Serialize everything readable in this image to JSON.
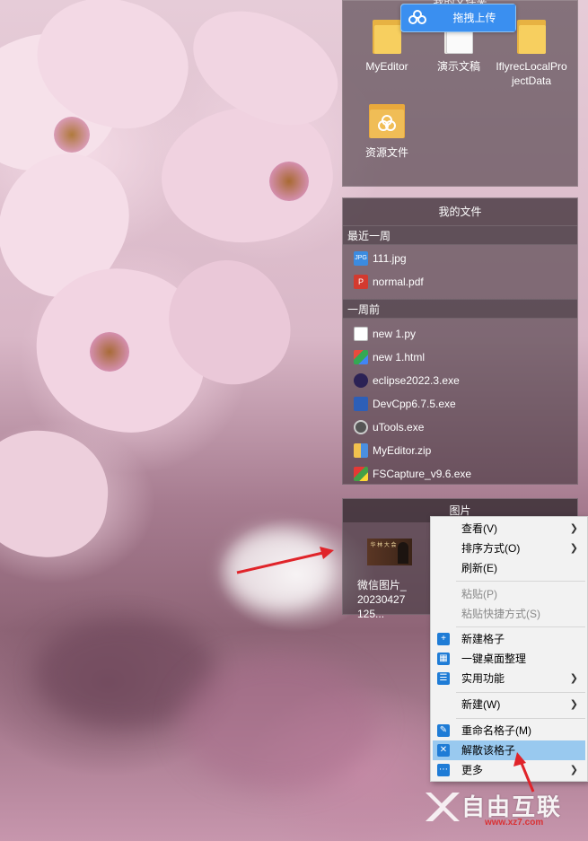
{
  "top_toolbar": {
    "upload_label": "拖拽上传",
    "partial_title": "我的文件夹"
  },
  "desktop_items": [
    {
      "label": "MyEditor",
      "icon": "folder-icon"
    },
    {
      "label": "演示文稿",
      "icon": "document-folder-icon"
    },
    {
      "label": "IflyrecLocalProjectData",
      "icon": "folder-icon"
    },
    {
      "label": "资源文件",
      "icon": "resource-folder-icon"
    }
  ],
  "my_files": {
    "title": "我的文件",
    "sections": [
      {
        "heading": "最近一周",
        "files": [
          {
            "name": "111.jpg",
            "icon": "jpg-icon"
          },
          {
            "name": "normal.pdf",
            "icon": "pdf-icon"
          }
        ]
      },
      {
        "heading": "一周前",
        "files": [
          {
            "name": "new 1.py",
            "icon": "py-file-icon"
          },
          {
            "name": "new 1.html",
            "icon": "html-file-icon"
          },
          {
            "name": "eclipse2022.3.exe",
            "icon": "eclipse-icon"
          },
          {
            "name": "DevCpp6.7.5.exe",
            "icon": "devcpp-icon"
          },
          {
            "name": "uTools.exe",
            "icon": "utools-icon"
          },
          {
            "name": "MyEditor.zip",
            "icon": "zip-icon"
          },
          {
            "name": "FSCapture_v9.6.exe",
            "icon": "fscapture-icon"
          }
        ]
      }
    ]
  },
  "pictures": {
    "title": "图片",
    "item_label": "微信图片_20230427125...",
    "thumb_text": "华 林 大 会"
  },
  "context_menu": {
    "items": [
      {
        "label": "查看(V)",
        "submenu": true
      },
      {
        "label": "排序方式(O)",
        "submenu": true
      },
      {
        "label": "刷新(E)"
      },
      {
        "label": "粘贴(P)",
        "disabled": true
      },
      {
        "label": "粘贴快捷方式(S)",
        "disabled": true
      },
      {
        "label": "新建格子",
        "icon": "plus-icon"
      },
      {
        "label": "一键桌面整理",
        "icon": "layout-icon"
      },
      {
        "label": "实用功能",
        "icon": "list-icon",
        "submenu": true
      },
      {
        "label": "新建(W)",
        "submenu": true
      },
      {
        "label": "重命名格子(M)",
        "icon": "rename-icon"
      },
      {
        "label": "解散该格子",
        "icon": "dissolve-icon",
        "highlighted": true
      },
      {
        "label": "更多",
        "icon": "more-icon",
        "submenu": true
      }
    ]
  },
  "watermark": {
    "text": "自由互联",
    "url": "www.xz7.com"
  },
  "colors": {
    "menu_highlight": "#99c9ef",
    "accent_blue": "#1f7cd6",
    "annotation_red": "#e0242a"
  }
}
